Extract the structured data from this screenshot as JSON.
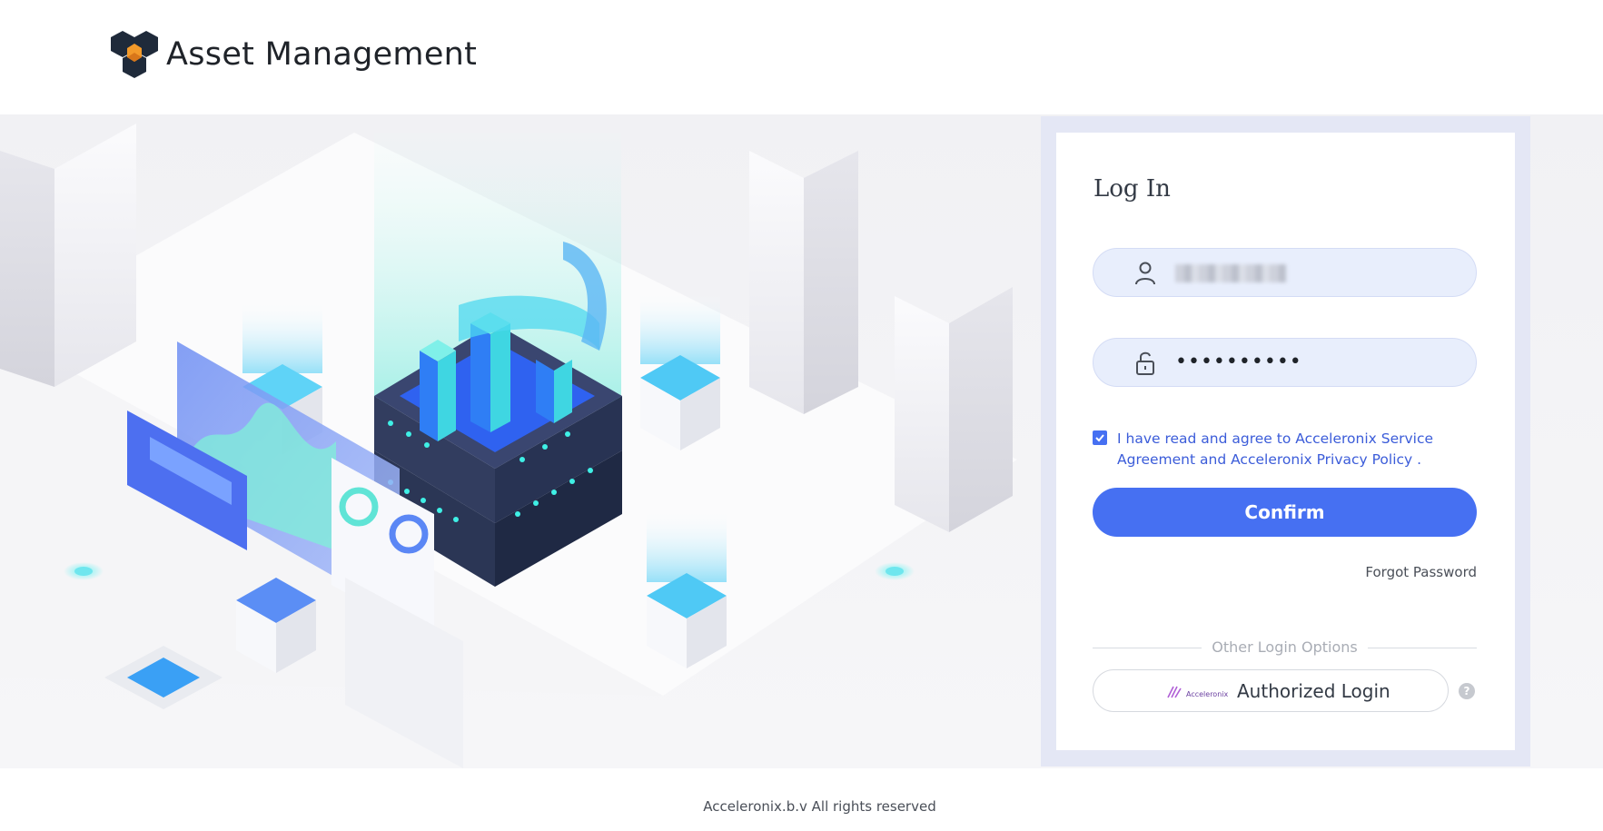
{
  "header": {
    "title": "Asset Management",
    "logo_icon": "hexagon-cube-logo-icon"
  },
  "login": {
    "title": "Log In",
    "username": {
      "icon": "user-icon",
      "value_blurred": true
    },
    "password": {
      "icon": "unlock-icon",
      "masked_value": "••••••••••"
    },
    "agreement": {
      "checked": true,
      "text": "I have read and agree to Acceleronix Service Agreement and Acceleronix Privacy Policy ."
    },
    "confirm_label": "Confirm",
    "forgot_label": "Forgot Password",
    "other_options_label": "Other Login Options",
    "authorized": {
      "logo_text": "Acceleronix",
      "label": "Authorized Login",
      "help_icon": "question-circle-icon",
      "help_glyph": "?"
    }
  },
  "footer": {
    "text": "Acceleronix.b.v All rights reserved"
  },
  "colors": {
    "accent": "#4670f2",
    "field_bg": "#e8eefc",
    "frame_bg": "#e4e7f5",
    "link_text": "#3b5cd9"
  }
}
